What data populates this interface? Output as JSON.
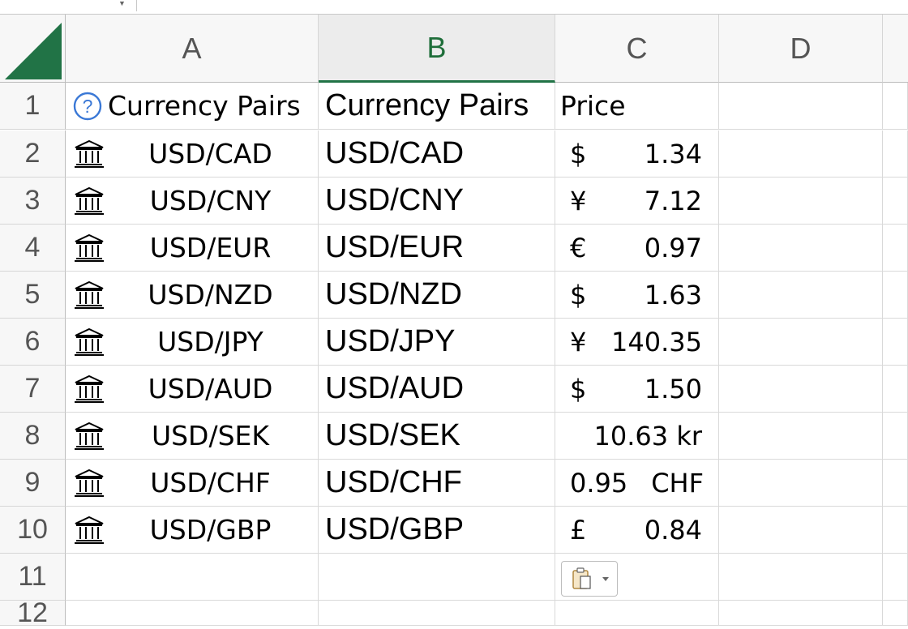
{
  "columns": [
    "A",
    "B",
    "C",
    "D"
  ],
  "rows": [
    "1",
    "2",
    "3",
    "4",
    "5",
    "6",
    "7",
    "8",
    "9",
    "10",
    "11",
    "12"
  ],
  "header_row": {
    "a": "Currency Pairs",
    "b": "Currency Pairs",
    "c": "Price"
  },
  "data_rows": [
    {
      "a": "USD/CAD",
      "b": "USD/CAD",
      "sym": "$",
      "val": "1.34"
    },
    {
      "a": "USD/CNY",
      "b": "USD/CNY",
      "sym": "¥",
      "val": "7.12"
    },
    {
      "a": "USD/EUR",
      "b": "USD/EUR",
      "sym": "€",
      "val": "0.97"
    },
    {
      "a": "USD/NZD",
      "b": "USD/NZD",
      "sym": "$",
      "val": "1.63"
    },
    {
      "a": "USD/JPY",
      "b": "USD/JPY",
      "sym": "¥",
      "val": "140.35"
    },
    {
      "a": "USD/AUD",
      "b": "USD/AUD",
      "sym": "$",
      "val": "1.50"
    },
    {
      "a": "USD/SEK",
      "b": "USD/SEK",
      "sym": "",
      "val": "10.63 kr"
    },
    {
      "a": "USD/CHF",
      "b": "USD/CHF",
      "sym": "0.95",
      "val": "CHF"
    },
    {
      "a": "USD/GBP",
      "b": "USD/GBP",
      "sym": "£",
      "val": "0.84"
    }
  ],
  "icons": {
    "row_icon": "bank-building-icon",
    "header_icon": "help-question-icon",
    "paste_options": "paste-options-icon"
  },
  "selected_column": "B",
  "accent_color": "#217346"
}
